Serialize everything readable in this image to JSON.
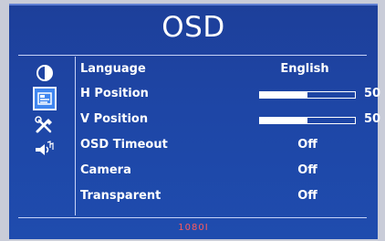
{
  "title": "OSD",
  "sidebar": {
    "icons": [
      {
        "name": "contrast-icon",
        "selected": false
      },
      {
        "name": "osd-settings-icon",
        "selected": true
      },
      {
        "name": "tools-icon",
        "selected": false
      },
      {
        "name": "audio-icon",
        "selected": false
      }
    ]
  },
  "menu": {
    "items": [
      {
        "label": "Language",
        "value": "English",
        "type": "text"
      },
      {
        "label": "H Position",
        "value": "50",
        "type": "slider",
        "fraction": 0.5
      },
      {
        "label": "V Position",
        "value": "50",
        "type": "slider",
        "fraction": 0.5
      },
      {
        "label": "OSD Timeout",
        "value": "Off",
        "type": "text"
      },
      {
        "label": "Camera",
        "value": "Off",
        "type": "text"
      },
      {
        "label": "Transparent",
        "value": "Off",
        "type": "text"
      }
    ]
  },
  "status": {
    "resolution": "1080I"
  }
}
